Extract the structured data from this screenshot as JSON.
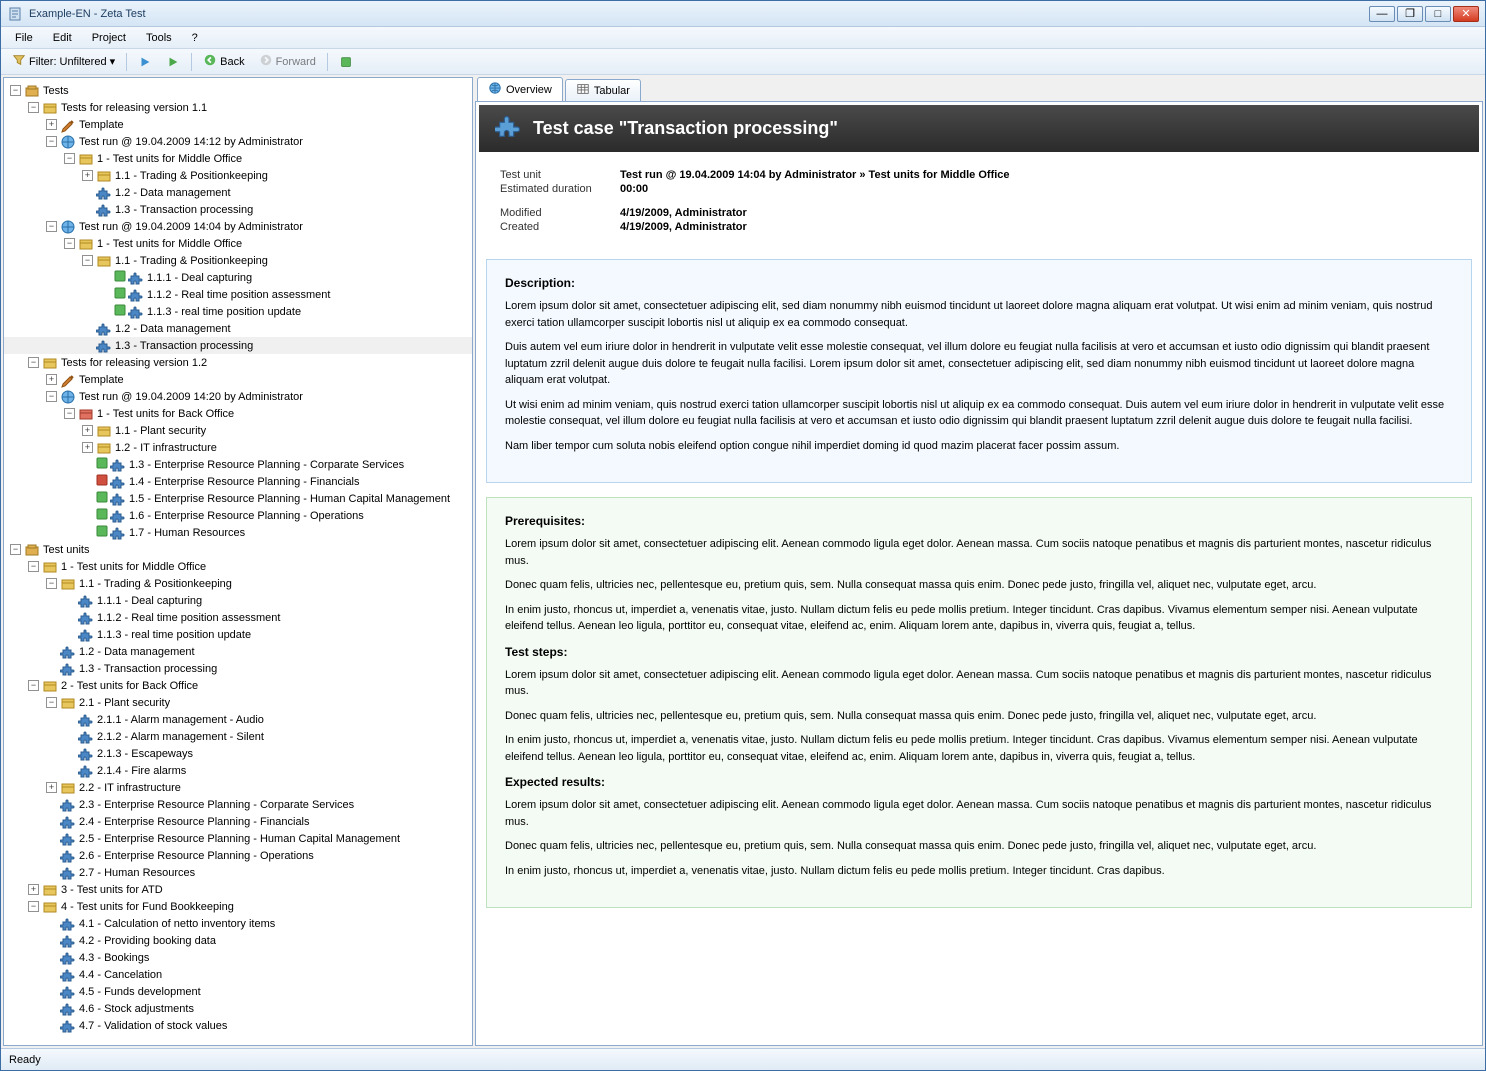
{
  "window": {
    "title": "Example-EN - Zeta Test"
  },
  "menu": {
    "file": "File",
    "edit": "Edit",
    "project": "Project",
    "tools": "Tools",
    "help": "?"
  },
  "toolbar": {
    "filter_label": "Filter:",
    "filter_value": "Unfiltered",
    "back": "Back",
    "forward": "Forward"
  },
  "tabs": {
    "overview": "Overview",
    "tabular": "Tabular"
  },
  "header": {
    "title": "Test case \"Transaction processing\""
  },
  "meta": {
    "test_unit_lbl": "Test unit",
    "test_unit_val": "Test run @ 19.04.2009 14:04 by Administrator » Test units for Middle Office",
    "dur_lbl": "Estimated duration",
    "dur_val": "00:00",
    "mod_lbl": "Modified",
    "mod_val": "4/19/2009, Administrator",
    "cre_lbl": "Created",
    "cre_val": "4/19/2009, Administrator"
  },
  "desc": {
    "h": "Description:",
    "p1": "Lorem ipsum dolor sit amet, consectetuer adipiscing elit, sed diam nonummy nibh euismod tincidunt ut laoreet dolore magna aliquam erat volutpat. Ut wisi enim ad minim veniam, quis nostrud exerci tation ullamcorper suscipit lobortis nisl ut aliquip ex ea commodo consequat.",
    "p2": "Duis autem vel eum iriure dolor in hendrerit in vulputate velit esse molestie consequat, vel illum dolore eu feugiat nulla facilisis at vero et accumsan et iusto odio dignissim qui blandit praesent luptatum zzril delenit augue duis dolore te feugait nulla facilisi. Lorem ipsum dolor sit amet, consectetuer adipiscing elit, sed diam nonummy nibh euismod tincidunt ut laoreet dolore magna aliquam erat volutpat.",
    "p3": "Ut wisi enim ad minim veniam, quis nostrud exerci tation ullamcorper suscipit lobortis nisl ut aliquip ex ea commodo consequat. Duis autem vel eum iriure dolor in hendrerit in vulputate velit esse molestie consequat, vel illum dolore eu feugiat nulla facilisis at vero et accumsan et iusto odio dignissim qui blandit praesent luptatum zzril delenit augue duis dolore te feugait nulla facilisi.",
    "p4": "Nam liber tempor cum soluta nobis eleifend option congue nihil imperdiet doming id quod mazim placerat facer possim assum."
  },
  "prereq": {
    "h": "Prerequisites:",
    "p1": "Lorem ipsum dolor sit amet, consectetuer adipiscing elit. Aenean commodo ligula eget dolor. Aenean massa. Cum sociis natoque penatibus et magnis dis parturient montes, nascetur ridiculus mus.",
    "p2": "Donec quam felis, ultricies nec, pellentesque eu, pretium quis, sem. Nulla consequat massa quis enim. Donec pede justo, fringilla vel, aliquet nec, vulputate eget, arcu.",
    "p3": "In enim justo, rhoncus ut, imperdiet a, venenatis vitae, justo. Nullam dictum felis eu pede mollis pretium. Integer tincidunt. Cras dapibus. Vivamus elementum semper nisi. Aenean vulputate eleifend tellus. Aenean leo ligula, porttitor eu, consequat vitae, eleifend ac, enim. Aliquam lorem ante, dapibus in, viverra quis, feugiat a, tellus."
  },
  "steps": {
    "h": "Test steps:",
    "p1": "Lorem ipsum dolor sit amet, consectetuer adipiscing elit. Aenean commodo ligula eget dolor. Aenean massa. Cum sociis natoque penatibus et magnis dis parturient montes, nascetur ridiculus mus.",
    "p2": "Donec quam felis, ultricies nec, pellentesque eu, pretium quis, sem. Nulla consequat massa quis enim. Donec pede justo, fringilla vel, aliquet nec, vulputate eget, arcu.",
    "p3": "In enim justo, rhoncus ut, imperdiet a, venenatis vitae, justo. Nullam dictum felis eu pede mollis pretium. Integer tincidunt. Cras dapibus. Vivamus elementum semper nisi. Aenean vulputate eleifend tellus. Aenean leo ligula, porttitor eu, consequat vitae, eleifend ac, enim. Aliquam lorem ante, dapibus in, viverra quis, feugiat a, tellus."
  },
  "expected": {
    "h": "Expected results:",
    "p1": "Lorem ipsum dolor sit amet, consectetuer adipiscing elit. Aenean commodo ligula eget dolor. Aenean massa. Cum sociis natoque penatibus et magnis dis parturient montes, nascetur ridiculus mus.",
    "p2": "Donec quam felis, ultricies nec, pellentesque eu, pretium quis, sem. Nulla consequat massa quis enim. Donec pede justo, fringilla vel, aliquet nec, vulputate eget, arcu.",
    "p3": "In enim justo, rhoncus ut, imperdiet a, venenatis vitae, justo. Nullam dictum felis eu pede mollis pretium. Integer tincidunt. Cras dapibus."
  },
  "status": "Ready",
  "tree": [
    {
      "d": 0,
      "e": "-",
      "i": "tests",
      "t": "Tests"
    },
    {
      "d": 1,
      "e": "-",
      "i": "box",
      "t": "Tests for releasing version 1.1"
    },
    {
      "d": 2,
      "e": "+",
      "i": "brush",
      "t": "Template"
    },
    {
      "d": 2,
      "e": "-",
      "i": "globe",
      "t": "Test run @ 19.04.2009 14:12 by Administrator"
    },
    {
      "d": 3,
      "e": "-",
      "i": "box",
      "t": "1 - Test units for Middle Office"
    },
    {
      "d": 4,
      "e": "+",
      "i": "box",
      "t": "1.1 - Trading & Positionkeeping"
    },
    {
      "d": 4,
      "e": "",
      "i": "puzzle",
      "t": "1.2 - Data management"
    },
    {
      "d": 4,
      "e": "",
      "i": "puzzle",
      "t": "1.3 - Transaction processing"
    },
    {
      "d": 2,
      "e": "-",
      "i": "globe",
      "t": "Test run @ 19.04.2009 14:04 by Administrator"
    },
    {
      "d": 3,
      "e": "-",
      "i": "box",
      "t": "1 - Test units for Middle Office"
    },
    {
      "d": 4,
      "e": "-",
      "i": "box",
      "t": "1.1 - Trading & Positionkeeping"
    },
    {
      "d": 5,
      "e": "",
      "i": "puzzle",
      "t": "1.1.1 - Deal capturing",
      "pre": "g"
    },
    {
      "d": 5,
      "e": "",
      "i": "puzzle",
      "t": "1.1.2 - Real time position assessment",
      "pre": "g"
    },
    {
      "d": 5,
      "e": "",
      "i": "puzzle",
      "t": "1.1.3 - real time position update",
      "pre": "g"
    },
    {
      "d": 4,
      "e": "",
      "i": "puzzle",
      "t": "1.2 - Data management"
    },
    {
      "d": 4,
      "e": "",
      "i": "puzzle",
      "t": "1.3 - Transaction processing",
      "sel": true
    },
    {
      "d": 1,
      "e": "-",
      "i": "box",
      "t": "Tests for releasing version 1.2"
    },
    {
      "d": 2,
      "e": "+",
      "i": "brush",
      "t": "Template"
    },
    {
      "d": 2,
      "e": "-",
      "i": "globe",
      "t": "Test run @ 19.04.2009 14:20 by Administrator"
    },
    {
      "d": 3,
      "e": "-",
      "i": "box-r",
      "t": "1 - Test units for Back Office"
    },
    {
      "d": 4,
      "e": "+",
      "i": "box",
      "t": "1.1 - Plant security"
    },
    {
      "d": 4,
      "e": "+",
      "i": "box",
      "t": "1.2 - IT infrastructure"
    },
    {
      "d": 4,
      "e": "",
      "i": "puzzle",
      "t": "1.3 - Enterprise Resource Planning - Corparate Services",
      "pre": "g"
    },
    {
      "d": 4,
      "e": "",
      "i": "puzzle",
      "t": "1.4 - Enterprise Resource Planning - Financials",
      "pre": "r"
    },
    {
      "d": 4,
      "e": "",
      "i": "puzzle",
      "t": "1.5 - Enterprise Resource Planning - Human Capital Management",
      "pre": "g"
    },
    {
      "d": 4,
      "e": "",
      "i": "puzzle",
      "t": "1.6 - Enterprise Resource Planning - Operations",
      "pre": "g"
    },
    {
      "d": 4,
      "e": "",
      "i": "puzzle",
      "t": "1.7 - Human Resources",
      "pre": "g"
    },
    {
      "d": 0,
      "e": "-",
      "i": "tests",
      "t": "Test units"
    },
    {
      "d": 1,
      "e": "-",
      "i": "box",
      "t": "1 - Test units for Middle Office"
    },
    {
      "d": 2,
      "e": "-",
      "i": "box",
      "t": "1.1 - Trading & Positionkeeping"
    },
    {
      "d": 3,
      "e": "",
      "i": "puzzle",
      "t": "1.1.1 - Deal capturing"
    },
    {
      "d": 3,
      "e": "",
      "i": "puzzle",
      "t": "1.1.2 - Real time position assessment"
    },
    {
      "d": 3,
      "e": "",
      "i": "puzzle",
      "t": "1.1.3 - real time position update"
    },
    {
      "d": 2,
      "e": "",
      "i": "puzzle",
      "t": "1.2 - Data management"
    },
    {
      "d": 2,
      "e": "",
      "i": "puzzle",
      "t": "1.3 - Transaction processing"
    },
    {
      "d": 1,
      "e": "-",
      "i": "box",
      "t": "2 - Test units for Back Office"
    },
    {
      "d": 2,
      "e": "-",
      "i": "box",
      "t": "2.1 - Plant security"
    },
    {
      "d": 3,
      "e": "",
      "i": "puzzle",
      "t": "2.1.1 - Alarm management - Audio"
    },
    {
      "d": 3,
      "e": "",
      "i": "puzzle",
      "t": "2.1.2 - Alarm management - Silent"
    },
    {
      "d": 3,
      "e": "",
      "i": "puzzle",
      "t": "2.1.3 - Escapeways"
    },
    {
      "d": 3,
      "e": "",
      "i": "puzzle",
      "t": "2.1.4 - Fire alarms"
    },
    {
      "d": 2,
      "e": "+",
      "i": "box",
      "t": "2.2 - IT infrastructure"
    },
    {
      "d": 2,
      "e": "",
      "i": "puzzle",
      "t": "2.3 - Enterprise Resource Planning - Corparate Services"
    },
    {
      "d": 2,
      "e": "",
      "i": "puzzle",
      "t": "2.4 - Enterprise Resource Planning - Financials"
    },
    {
      "d": 2,
      "e": "",
      "i": "puzzle",
      "t": "2.5 - Enterprise Resource Planning - Human Capital Management"
    },
    {
      "d": 2,
      "e": "",
      "i": "puzzle",
      "t": "2.6 - Enterprise Resource Planning - Operations"
    },
    {
      "d": 2,
      "e": "",
      "i": "puzzle",
      "t": "2.7 - Human Resources"
    },
    {
      "d": 1,
      "e": "+",
      "i": "box",
      "t": "3 - Test units for ATD"
    },
    {
      "d": 1,
      "e": "-",
      "i": "box",
      "t": "4 - Test units for Fund Bookkeeping"
    },
    {
      "d": 2,
      "e": "",
      "i": "puzzle",
      "t": "4.1 - Calculation of netto inventory items"
    },
    {
      "d": 2,
      "e": "",
      "i": "puzzle",
      "t": "4.2 - Providing booking data"
    },
    {
      "d": 2,
      "e": "",
      "i": "puzzle",
      "t": "4.3 - Bookings"
    },
    {
      "d": 2,
      "e": "",
      "i": "puzzle",
      "t": "4.4 - Cancelation"
    },
    {
      "d": 2,
      "e": "",
      "i": "puzzle",
      "t": "4.5 - Funds development"
    },
    {
      "d": 2,
      "e": "",
      "i": "puzzle",
      "t": "4.6 - Stock adjustments"
    },
    {
      "d": 2,
      "e": "",
      "i": "puzzle",
      "t": "4.7 - Validation of stock values"
    }
  ]
}
